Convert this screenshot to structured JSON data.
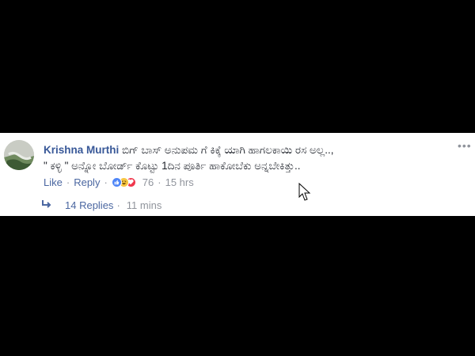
{
  "comment": {
    "author": "Krishna Murthi",
    "text_line1": "ಬಿಗ್ ಬಾಸ್ ಅನುಪಮ ಗೆ ಕಿಕ್ಕೆ ಯಾಗಿ ಹಾಗಲಕಾಯಿ ರಸ ಅಲ್ಲ..,",
    "text_line2": "\" ಕಳ್ಳಿ \" ಅನ್ನೋ ಬೋರ್ಡ್ ಕೊಟ್ಟು 1ದಿನ ಪೂರ್ತಿ ಹಾಕೋಬೆಕು ಅನ್ನಬೇಕಿತ್ತು..",
    "options_icon": "more-dots-icon"
  },
  "actions": {
    "like_label": "Like",
    "separator": "·",
    "reply_label": "Reply",
    "reactions": [
      "like-icon",
      "haha-icon",
      "love-icon"
    ],
    "reaction_count": "76",
    "time": "15 hrs"
  },
  "replies": {
    "arrow_icon": "reply-arrow-icon",
    "label": "14 Replies",
    "separator": "·",
    "time": "11 mins"
  },
  "colors": {
    "background": "#000000",
    "card": "#ffffff",
    "link": "#385898",
    "muted": "#90949c"
  }
}
